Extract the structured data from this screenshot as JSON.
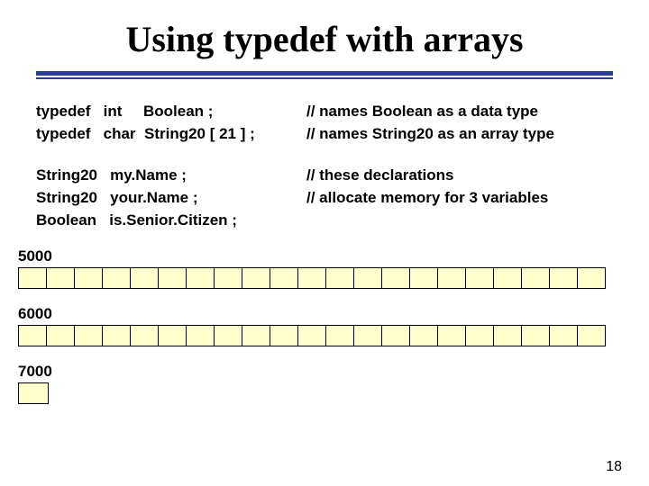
{
  "title_parts": {
    "pre": "Using  ",
    "kw": "typedef",
    "post": "  with arrays"
  },
  "code": {
    "l1_left": "typedef   int     Boolean ;",
    "l1_right": "// names Boolean  as a data type",
    "l2_left": "typedef   char  String20 [ 21 ] ;",
    "l2_right": "// names String20  as an array type",
    "l3_left": "String20   my.Name ;",
    "l3_right": "// these declarations",
    "l4_left": "String20   your.Name ;",
    "l4_right": "// allocate memory for  3  variables",
    "l5_left": "Boolean   is.Senior.Citizen ;"
  },
  "mem": {
    "addr1": "5000",
    "count1": 21,
    "addr2": "6000",
    "count2": 21,
    "addr3": "7000",
    "count3": 1
  },
  "page_num": "18"
}
